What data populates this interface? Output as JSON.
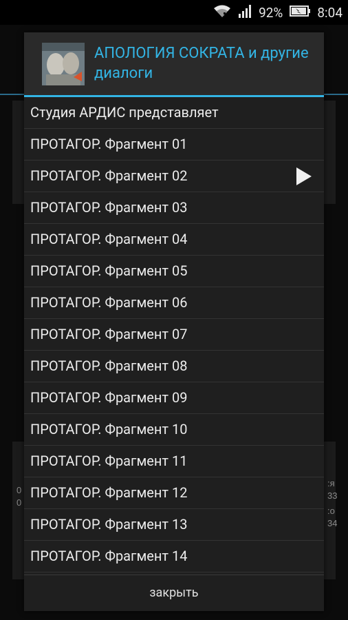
{
  "status_bar": {
    "battery_percent": "92%",
    "time": "8:04",
    "icons": [
      "wifi-icon",
      "signal-icon",
      "battery-icon"
    ]
  },
  "background": {
    "side_text_right": [
      ":я",
      "33",
      ":о",
      "34"
    ],
    "side_text_left": [
      "0",
      "0"
    ]
  },
  "dialog": {
    "title": "АПОЛОГИЯ СОКРАТА и другие диалоги",
    "accent_color": "#33b5e5",
    "items": [
      {
        "label": "Студия АРДИС представляет",
        "playing": false
      },
      {
        "label": "ПРОТАГОР. Фрагмент 01",
        "playing": false
      },
      {
        "label": "ПРОТАГОР. Фрагмент 02",
        "playing": true
      },
      {
        "label": "ПРОТАГОР. Фрагмент 03",
        "playing": false
      },
      {
        "label": "ПРОТАГОР. Фрагмент 04",
        "playing": false
      },
      {
        "label": "ПРОТАГОР. Фрагмент 05",
        "playing": false
      },
      {
        "label": "ПРОТАГОР. Фрагмент 06",
        "playing": false
      },
      {
        "label": "ПРОТАГОР. Фрагмент 07",
        "playing": false
      },
      {
        "label": "ПРОТАГОР. Фрагмент 08",
        "playing": false
      },
      {
        "label": "ПРОТАГОР. Фрагмент 09",
        "playing": false
      },
      {
        "label": "ПРОТАГОР. Фрагмент 10",
        "playing": false
      },
      {
        "label": "ПРОТАГОР. Фрагмент 11",
        "playing": false
      },
      {
        "label": "ПРОТАГОР. Фрагмент 12",
        "playing": false
      },
      {
        "label": "ПРОТАГОР. Фрагмент 13",
        "playing": false
      },
      {
        "label": "ПРОТАГОР. Фрагмент 14",
        "playing": false
      }
    ],
    "close_label": "закрыть"
  }
}
